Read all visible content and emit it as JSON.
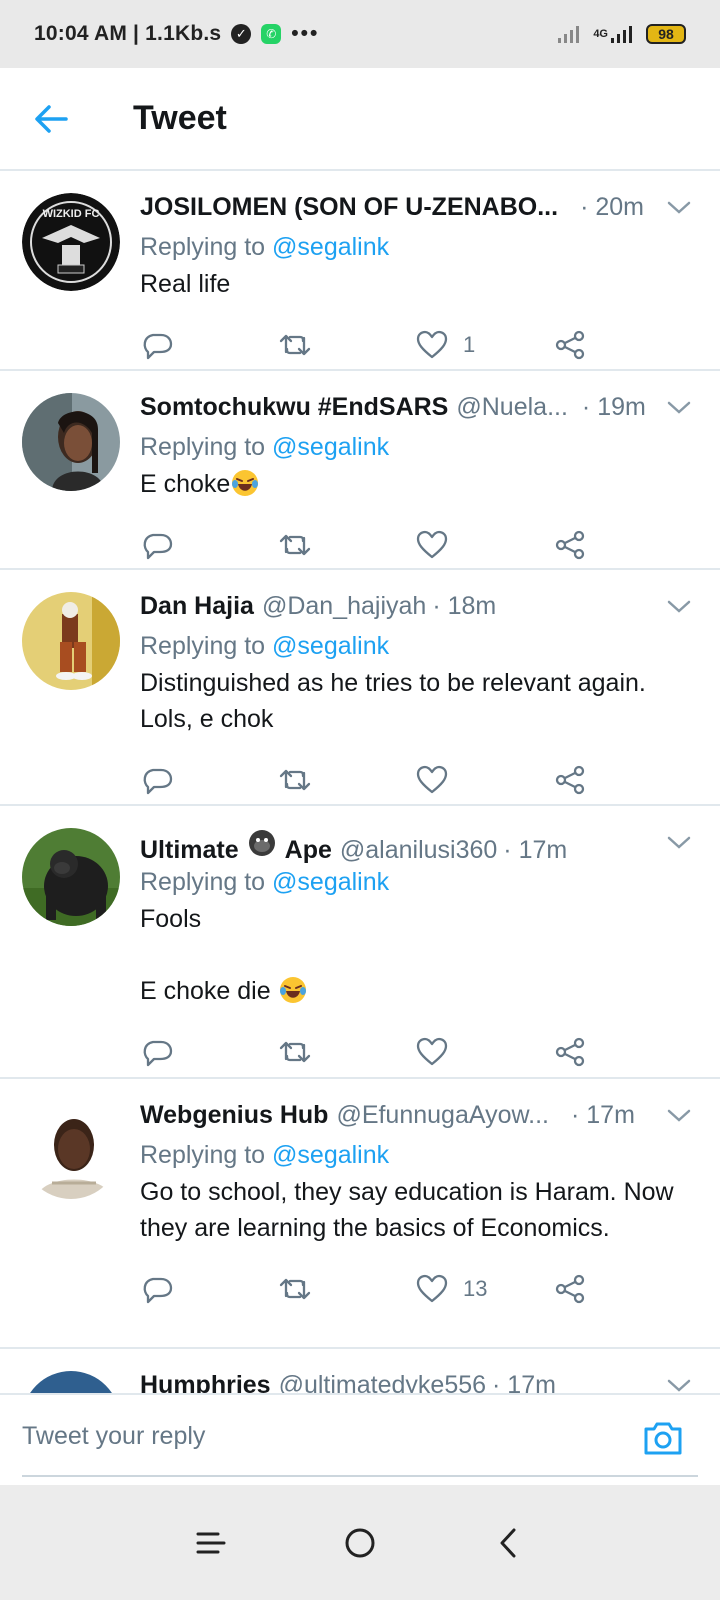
{
  "status_bar": {
    "time": "10:04 AM | 1.1Kb.s",
    "network": "4G",
    "battery": "98",
    "menu_dots": "•••"
  },
  "header": {
    "title": "Tweet",
    "back_icon": "arrow-left-icon"
  },
  "colors": {
    "accent": "#1da1f2",
    "secondary_text": "#657786",
    "divider": "#e1e8ed"
  },
  "tweets": [
    {
      "name": "JOSILOMEN (SON OF U-ZENABO...",
      "handle": "",
      "time": "· 20m",
      "replying_prefix": "Replying to",
      "mention": "@segalink",
      "text": "Real life",
      "likes": "1",
      "avatar_text": "WIZKID FC"
    },
    {
      "name": "Somtochukwu #EndSARS",
      "handle": "@Nuela...",
      "time": "· 19m",
      "replying_prefix": "Replying to",
      "mention": "@segalink",
      "text": "E choke",
      "likes": ""
    },
    {
      "name": "Dan Hajia",
      "handle": "@Dan_hajiyah",
      "time": "· 18m",
      "replying_prefix": "Replying to",
      "mention": "@segalink",
      "text": "Distinguished as he tries to be relevant again. Lols, e chok",
      "likes": ""
    },
    {
      "name_part1": "Ultimate",
      "name_part2": "Ape",
      "handle": "@alanilusi360",
      "time": "· 17m",
      "replying_prefix": "Replying to",
      "mention": "@segalink",
      "text_line1": "Fools",
      "text_line2": "E choke die",
      "likes": ""
    },
    {
      "name": "Webgenius Hub",
      "handle": "@EfunnugaAyow...",
      "time": "· 17m",
      "replying_prefix": "Replying to",
      "mention": "@segalink",
      "text": "Go to school,  they say education is Haram. Now they are learning the basics of Economics.",
      "likes": "13"
    },
    {
      "name": "Humphries",
      "handle": "@ultimatedyke556",
      "time": "· 17m"
    }
  ],
  "reply": {
    "placeholder": "Tweet your reply"
  }
}
